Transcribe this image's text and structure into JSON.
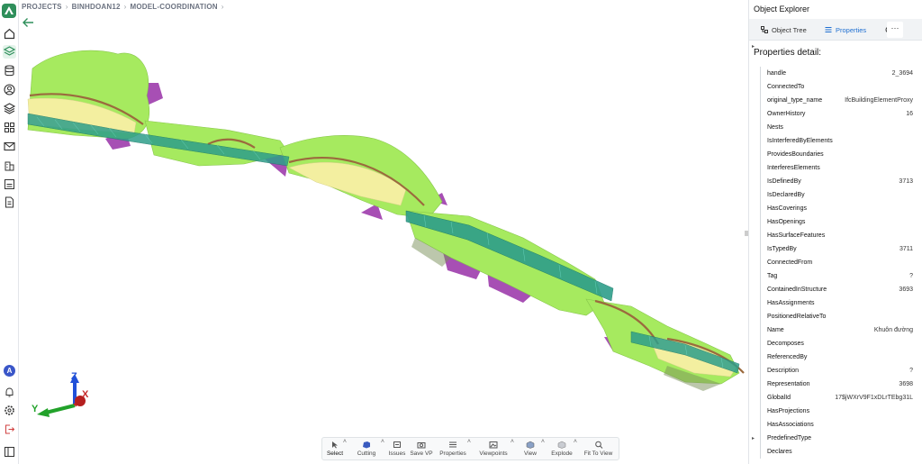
{
  "breadcrumb": [
    "PROJECTS",
    "BINHDOAN12",
    "MODEL-COORDINATION"
  ],
  "rail": {
    "icons": [
      "home-icon",
      "layers-icon",
      "database-icon",
      "user-circle-icon",
      "stack-icon",
      "grid-icon",
      "mail-icon",
      "building-icon",
      "report-icon",
      "document-icon"
    ],
    "bottom_icons": [
      "bell-icon",
      "gear-icon",
      "logout-icon",
      "sidebar-toggle-icon"
    ],
    "avatar_letter": "A",
    "accent": "#2f8f5b"
  },
  "axis": {
    "x_label": "X",
    "y_label": "Y",
    "z_label": "Z"
  },
  "toolbar": {
    "items": [
      {
        "label": "Select",
        "icon": "cursor-icon",
        "caret": true
      },
      {
        "label": "Cutting",
        "icon": "cube-cut-icon",
        "caret": true
      },
      {
        "label": "Issues",
        "icon": "issues-icon",
        "caret": false
      },
      {
        "label": "Save VP",
        "icon": "camera-icon",
        "caret": false
      },
      {
        "label": "Properties",
        "icon": "list-icon",
        "caret": true
      },
      {
        "label": "Viewpoints",
        "icon": "image-icon",
        "caret": true
      },
      {
        "label": "View",
        "icon": "view-cube-icon",
        "caret": true
      },
      {
        "label": "Explode",
        "icon": "explode-icon",
        "caret": true
      },
      {
        "label": "Fit To View",
        "icon": "zoom-fit-icon",
        "caret": false
      }
    ]
  },
  "panel": {
    "title": "Object Explorer",
    "tabs": [
      {
        "label": "Object Tree",
        "icon": "tree-icon"
      },
      {
        "label": "Properties",
        "icon": "list-icon"
      }
    ],
    "active_tab": "Properties",
    "more_label": "···",
    "heading": "Properties detail:",
    "accent": "#1f6fd1",
    "properties": [
      {
        "key": "handle",
        "value": "2_3694"
      },
      {
        "key": "ConnectedTo",
        "value": ""
      },
      {
        "key": "original_type_name",
        "value": "IfcBuildingElementProxy"
      },
      {
        "key": "OwnerHistory",
        "value": "16"
      },
      {
        "key": "Nests",
        "value": ""
      },
      {
        "key": "IsInterferedByElements",
        "value": ""
      },
      {
        "key": "ProvidesBoundaries",
        "value": ""
      },
      {
        "key": "InterferesElements",
        "value": ""
      },
      {
        "key": "IsDefinedBy",
        "value": "3713"
      },
      {
        "key": "IsDeclaredBy",
        "value": ""
      },
      {
        "key": "HasCoverings",
        "value": ""
      },
      {
        "key": "HasOpenings",
        "value": ""
      },
      {
        "key": "HasSurfaceFeatures",
        "value": ""
      },
      {
        "key": "IsTypedBy",
        "value": "3711"
      },
      {
        "key": "ConnectedFrom",
        "value": ""
      },
      {
        "key": "Tag",
        "value": "?"
      },
      {
        "key": "ContainedInStructure",
        "value": "3693"
      },
      {
        "key": "HasAssignments",
        "value": ""
      },
      {
        "key": "PositionedRelativeTo",
        "value": ""
      },
      {
        "key": "Name",
        "value": "Khuôn đường"
      },
      {
        "key": "Decomposes",
        "value": ""
      },
      {
        "key": "ReferencedBy",
        "value": ""
      },
      {
        "key": "Description",
        "value": "?"
      },
      {
        "key": "Representation",
        "value": "3698"
      },
      {
        "key": "GlobalId",
        "value": "17$jWXrV9F1xDLrTEbg31L"
      },
      {
        "key": "HasProjections",
        "value": ""
      },
      {
        "key": "HasAssociations",
        "value": ""
      },
      {
        "key": "PredefinedType",
        "value": ""
      },
      {
        "key": "Declares",
        "value": ""
      }
    ]
  },
  "model_colors": {
    "terrain": "#a6ea5f",
    "road": "#f3efa0",
    "deck": "#2e9e8a",
    "edge": "#9b6a3e",
    "cut": "#a74fb4"
  }
}
